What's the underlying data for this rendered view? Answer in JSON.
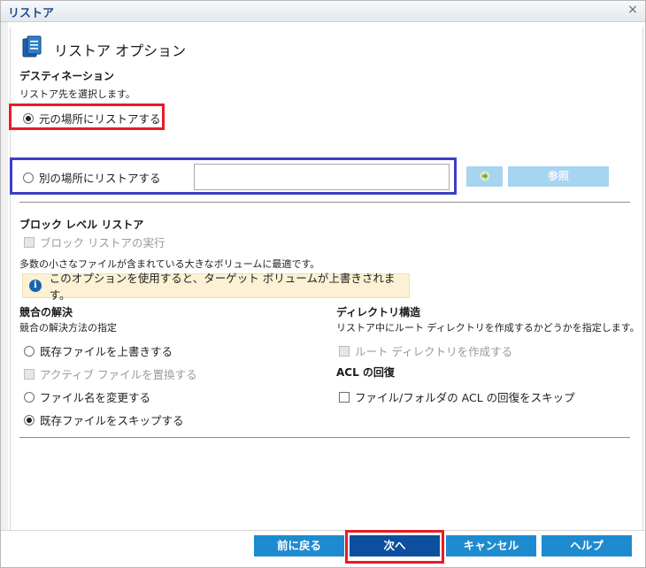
{
  "window": {
    "title": "リストア",
    "close_glyph": "×"
  },
  "header": {
    "title": "リストア オプション"
  },
  "destination": {
    "heading": "デスティネーション",
    "description": "リストア先を選択します。",
    "option_original": "元の場所にリストアする",
    "option_alternate": "別の場所にリストアする",
    "path_value": "",
    "browse_label": "参照"
  },
  "block_level": {
    "heading": "ブロック レベル リストア",
    "checkbox_label": "ブロック リストアの実行",
    "description": "多数の小さなファイルが含まれている大きなボリュームに最適です。",
    "info_text": "このオプションを使用すると、ターゲット ボリュームが上書きされます。"
  },
  "conflict": {
    "heading": "競合の解決",
    "description": "競合の解決方法の指定",
    "options": [
      {
        "label": "既存ファイルを上書きする",
        "state": "unchecked"
      },
      {
        "label": "アクティブ ファイルを置換する",
        "state": "disabled"
      },
      {
        "label": "ファイル名を変更する",
        "state": "unchecked"
      },
      {
        "label": "既存ファイルをスキップする",
        "state": "checked"
      }
    ]
  },
  "directory": {
    "heading": "ディレクトリ構造",
    "description": "リストア中にルート ディレクトリを作成するかどうかを指定します。",
    "checkbox_label": "ルート ディレクトリを作成する"
  },
  "acl": {
    "heading": "ACL の回復",
    "checkbox_label": "ファイル/フォルダの ACL の回復をスキップ"
  },
  "footer": {
    "back_label": "前に戻る",
    "next_label": "次へ",
    "cancel_label": "キャンセル",
    "help_label": "ヘルプ"
  },
  "colors": {
    "highlight_red": "#e81c25",
    "highlight_blue": "#3a3fc4",
    "button_blue": "#1e8bd0",
    "button_primary": "#0d4f9e",
    "info_bg": "#fcf1d4"
  }
}
